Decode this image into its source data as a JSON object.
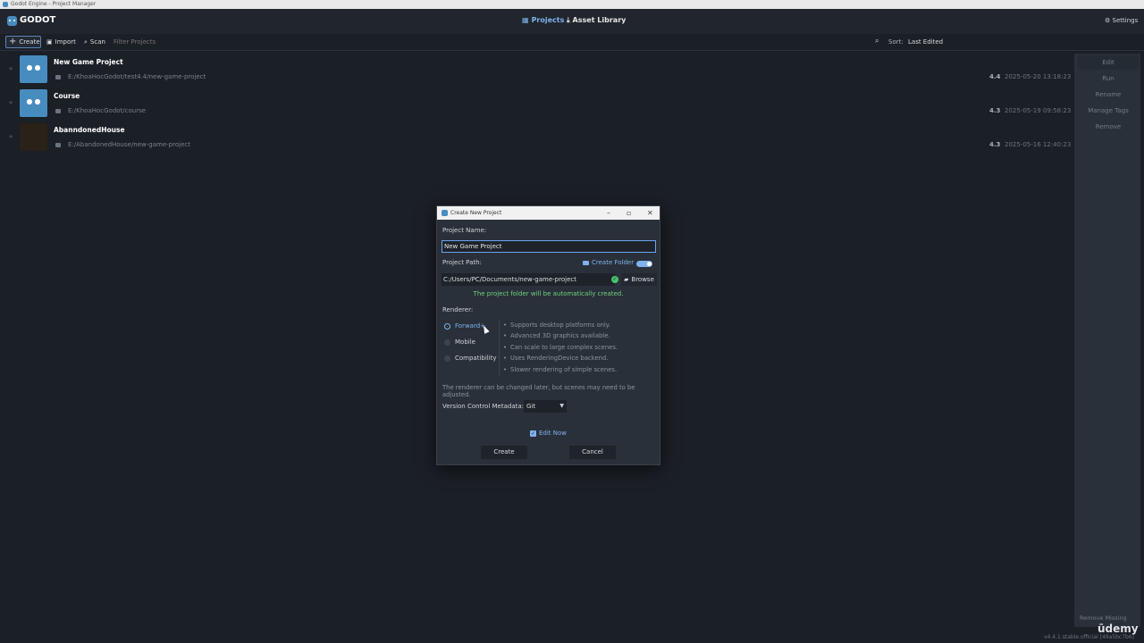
{
  "os": {
    "window_title": "Godot Engine - Project Manager"
  },
  "topbar": {
    "logo": "GODOT",
    "tabs": [
      {
        "label": "Projects"
      },
      {
        "label": "Asset Library"
      }
    ],
    "settings_label": "Settings"
  },
  "toolbar": {
    "create_label": "Create",
    "import_label": "Import",
    "scan_label": "Scan",
    "filter_placeholder": "Filter Projects",
    "sort_label": "Sort:",
    "sort_value": "Last Edited"
  },
  "projects": [
    {
      "name": "New Game Project",
      "path": "E:/KhoaHocGodot/test4.4/new-game-project",
      "version": "4.4",
      "date": "2025-05-20 13:18:23"
    },
    {
      "name": "Course",
      "path": "E:/KhoaHocGodot/course",
      "version": "4.3",
      "date": "2025-05-19 09:58:23"
    },
    {
      "name": "AbanndonedHouse",
      "path": "E:/AbandonedHouse/new-game-project",
      "version": "4.3",
      "date": "2025-05-16 12:40:23"
    }
  ],
  "side_panel": {
    "edit": "Edit",
    "run": "Run",
    "rename": "Rename",
    "manage_tags": "Manage Tags",
    "remove": "Remove",
    "remove_missing": "Remove Missing"
  },
  "dialog": {
    "title": "Create New Project",
    "project_name_label": "Project Name:",
    "project_name_value": "New Game Project",
    "project_path_label": "Project Path:",
    "create_folder_label": "Create Folder",
    "project_path_value": "C:/Users/PC/Documents/new-game-project",
    "browse_label": "Browse",
    "auto_created_message": "The project folder will be automatically created.",
    "renderer_label": "Renderer:",
    "renderers": [
      "Forward+",
      "Mobile",
      "Compatibility"
    ],
    "selected_renderer": "Forward+",
    "features": [
      "Supports desktop platforms only.",
      "Advanced 3D graphics available.",
      "Can scale to large complex scenes.",
      "Uses RenderingDevice backend.",
      "Slower rendering of simple scenes."
    ],
    "renderer_note": "The renderer can be changed later, but scenes may need to be adjusted.",
    "vcm_label": "Version Control Metadata:",
    "vcm_value": "Git",
    "edit_now_label": "Edit Now",
    "create_button": "Create",
    "cancel_button": "Cancel"
  },
  "footer": {
    "watermark": "ūdemy",
    "version": "v4.4.1.stable.official [49a5bc7b6]"
  },
  "colors": {
    "accent": "#7fb2f0",
    "success": "#6fd37f",
    "godot_blue": "#478cbf"
  }
}
